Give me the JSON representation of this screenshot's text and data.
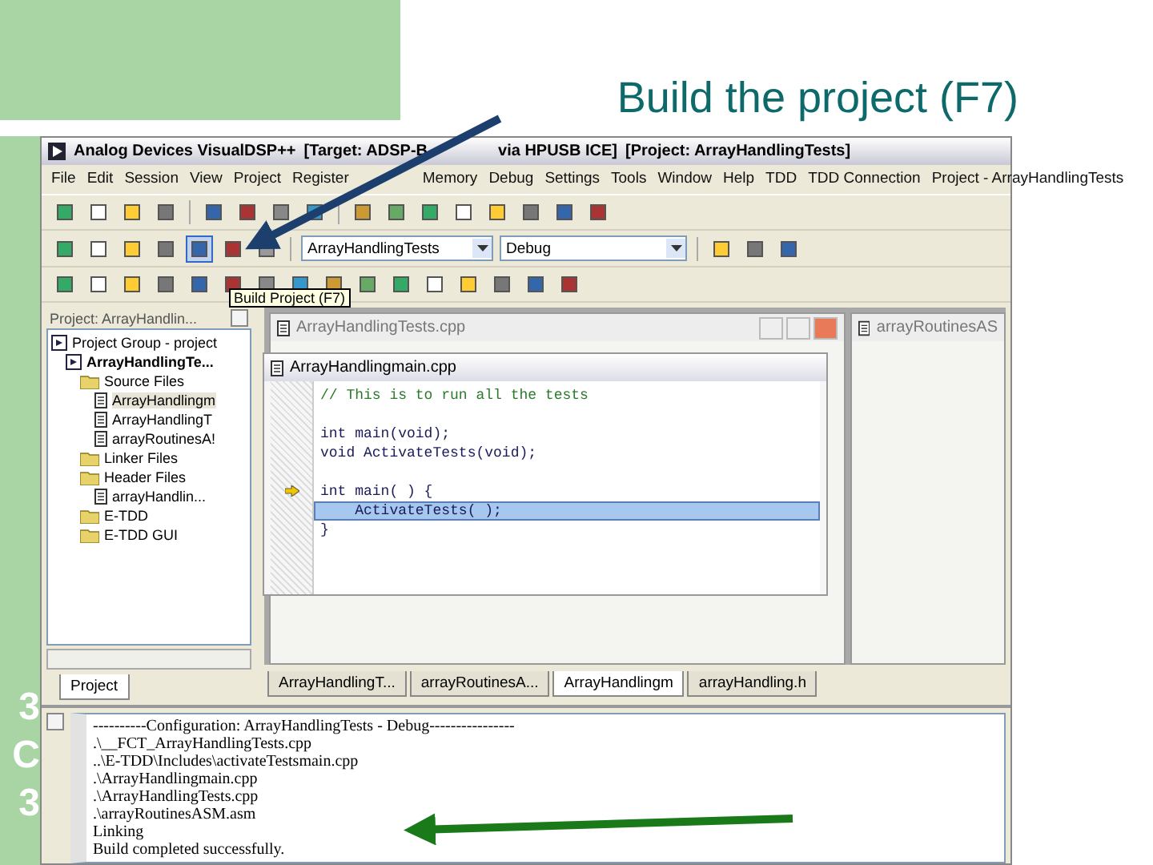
{
  "slide": {
    "title": "Build the project (F7)",
    "side_text": [
      "3",
      "C",
      "3"
    ]
  },
  "window": {
    "title_parts": [
      "Analog Devices VisualDSP++",
      "[Target: ADSP-B",
      "via HPUSB ICE]",
      "[Project: ArrayHandlingTests]"
    ],
    "menu": [
      "File",
      "Edit",
      "Session",
      "View",
      "Project",
      "Register",
      "Memory",
      "Debug",
      "Settings",
      "Tools",
      "Window",
      "Help",
      "TDD",
      "TDD Connection",
      "Project - ArrayHandlingTests"
    ],
    "project_combo": "ArrayHandlingTests",
    "config_combo": "Debug",
    "tooltip": "Build Project (F7)"
  },
  "project_panel": {
    "title": "Project: ArrayHandlin...",
    "tab": "Project",
    "tree": [
      {
        "label": "Project Group - project",
        "kind": "group",
        "children": [
          {
            "label": "ArrayHandlingTe...",
            "kind": "project",
            "children": [
              {
                "label": "Source Files",
                "kind": "folder",
                "children": [
                  {
                    "label": "ArrayHandlingm",
                    "kind": "file",
                    "selected": true
                  },
                  {
                    "label": "ArrayHandlingT",
                    "kind": "file",
                    "selected": false
                  },
                  {
                    "label": "arrayRoutinesA!",
                    "kind": "file",
                    "selected": false
                  }
                ]
              },
              {
                "label": "Linker Files",
                "kind": "folder"
              },
              {
                "label": "Header Files",
                "kind": "folder",
                "children": [
                  {
                    "label": "arrayHandlin...",
                    "kind": "file",
                    "selected": false
                  }
                ]
              },
              {
                "label": "E-TDD",
                "kind": "folder"
              },
              {
                "label": "E-TDD GUI",
                "kind": "folder"
              }
            ]
          }
        ]
      }
    ]
  },
  "editors": {
    "back_title": "ArrayHandlingTests.cpp",
    "right_title": "arrayRoutinesAS",
    "front": {
      "title": "ArrayHandlingmain.cpp",
      "lines": [
        {
          "text": "// This is to run all the tests",
          "kind": "comment",
          "current": false
        },
        {
          "kind": "blank",
          "current": false
        },
        {
          "text": "int main(void);",
          "kind": "code",
          "current": false
        },
        {
          "text": "void ActivateTests(void);",
          "kind": "code",
          "current": false
        },
        {
          "kind": "blank",
          "current": false
        },
        {
          "text": "int main( ) {",
          "kind": "code",
          "current": false
        },
        {
          "text": "    ActivateTests( );",
          "kind": "code",
          "current": true
        },
        {
          "text": "}",
          "kind": "code",
          "current": false
        }
      ]
    }
  },
  "doc_tabs": [
    {
      "label": "ArrayHandlingT...",
      "selected": false
    },
    {
      "label": "arrayRoutinesA...",
      "selected": false
    },
    {
      "label": "ArrayHandlingm",
      "selected": true
    },
    {
      "label": "arrayHandling.h",
      "selected": false
    }
  ],
  "output": {
    "lines": [
      "----------Configuration: ArrayHandlingTests - Debug----------------",
      ".\\__FCT_ArrayHandlingTests.cpp",
      "..\\E-TDD\\Includes\\activateTestsmain.cpp",
      ".\\ArrayHandlingmain.cpp",
      ".\\ArrayHandlingTests.cpp",
      ".\\arrayRoutinesASM.asm",
      "Linking",
      "Build completed successfully."
    ]
  }
}
